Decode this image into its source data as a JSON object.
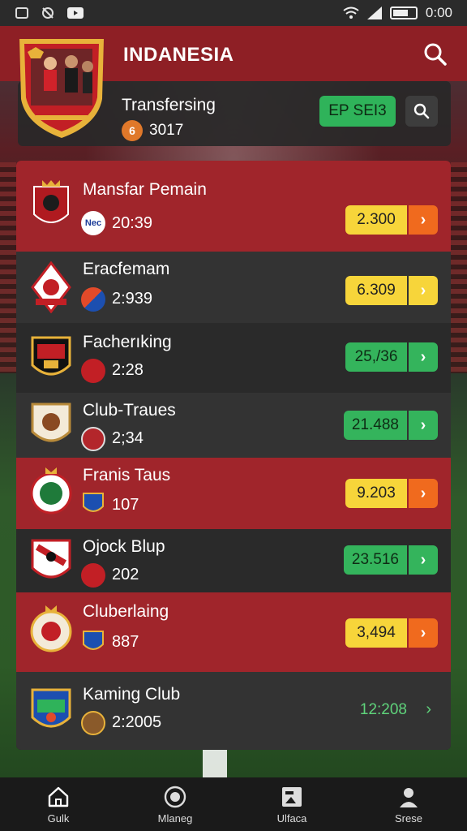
{
  "status_bar": {
    "time": "0:00"
  },
  "header": {
    "title": "INDANESIA"
  },
  "info_card": {
    "title": "Transfersing",
    "coin_glyph": "6",
    "count": "3017",
    "button_label": "EP SEI3"
  },
  "clubs": [
    {
      "name": "Mansfar Pemain",
      "stat": "20:39",
      "badge_text": "Nec",
      "price": "2.300",
      "style": "yellow"
    },
    {
      "name": "Eracfemam",
      "stat": "2:939",
      "price": "6.309",
      "style": "yellow"
    },
    {
      "name": "Facherıking",
      "stat": "2:28",
      "price": "25,/36",
      "style": "green"
    },
    {
      "name": "Club-Traues",
      "stat": "2;34",
      "price": "21.488",
      "style": "green"
    },
    {
      "name": "Franis Taus",
      "stat": "107",
      "price": "9.203",
      "style": "yellow"
    },
    {
      "name": "Ojock Blup",
      "stat": "202",
      "price": "23.516",
      "style": "green"
    },
    {
      "name": "Cluberlaing",
      "stat": "887",
      "price": "3,494",
      "style": "yellow"
    },
    {
      "name": "Kaming Club",
      "stat": "2:2005",
      "price": "12:208",
      "style": "plain"
    }
  ],
  "bottom_nav": [
    {
      "label": "Gulk",
      "icon": "home-icon"
    },
    {
      "label": "Mlaneg",
      "icon": "crest-icon"
    },
    {
      "label": "Ulfaca",
      "icon": "image-icon"
    },
    {
      "label": "Srese",
      "icon": "user-icon"
    }
  ],
  "colors": {
    "header_red": "#8e1f25",
    "row_red": "#a0252b",
    "price_yellow": "#f7d53a",
    "price_green": "#34b45c",
    "arrow_orange": "#f06a1e"
  }
}
